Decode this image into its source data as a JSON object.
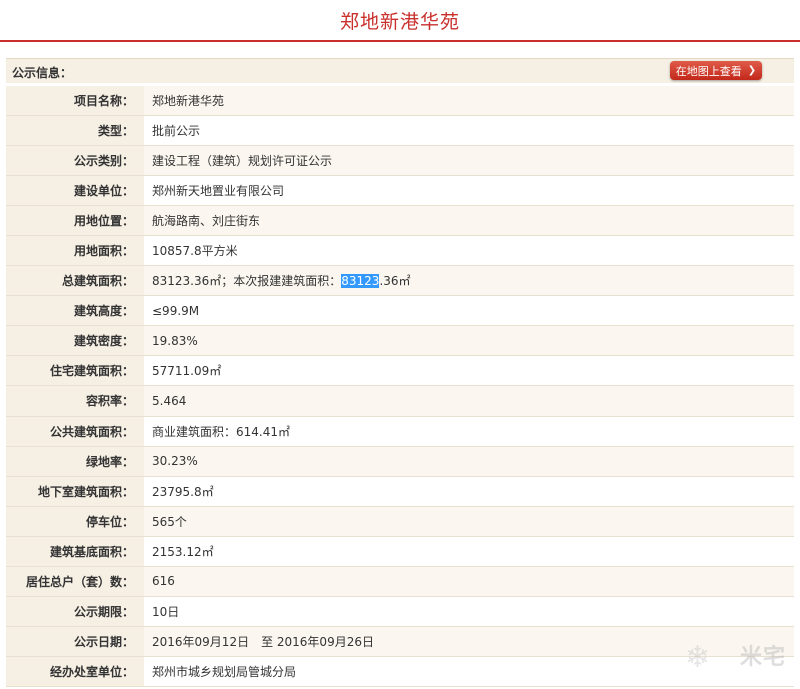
{
  "page": {
    "title": "郑地新港华苑"
  },
  "header": {
    "label": "公示信息：",
    "map_button": "在地图上查看"
  },
  "rows": [
    {
      "label": "项目名称：",
      "value": "郑地新港华苑"
    },
    {
      "label": "类型：",
      "value": "批前公示"
    },
    {
      "label": "公示类别：",
      "value": "建设工程（建筑）规划许可证公示"
    },
    {
      "label": "建设单位：",
      "value": "郑州新天地置业有限公司"
    },
    {
      "label": "用地位置：",
      "value": "航海路南、刘庄街东"
    },
    {
      "label": "用地面积：",
      "value": "10857.8平方米"
    },
    {
      "label": "总建筑面积：",
      "value": "83123.36㎡；本次报建建筑面积：",
      "highlight": "83123",
      "value_tail": ".36㎡"
    },
    {
      "label": "建筑高度：",
      "value": "≤99.9M"
    },
    {
      "label": "建筑密度：",
      "value": "19.83%"
    },
    {
      "label": "住宅建筑面积：",
      "value": "57711.09㎡"
    },
    {
      "label": "容积率：",
      "value": "5.464"
    },
    {
      "label": "公共建筑面积：",
      "value": "商业建筑面积：614.41㎡"
    },
    {
      "label": "绿地率：",
      "value": "30.23%"
    },
    {
      "label": "地下室建筑面积：",
      "value": "23795.8㎡"
    },
    {
      "label": "停车位：",
      "value": "565个"
    },
    {
      "label": "建筑基底面积：",
      "value": "2153.12㎡"
    },
    {
      "label": "居住总户（套）数：",
      "value": "616"
    },
    {
      "label": "公示期限：",
      "value": "10日"
    },
    {
      "label": "公示日期：",
      "value": "2016年09月12日　至 2016年09月26日"
    },
    {
      "label": "经办处室单位：",
      "value": "郑州市城乡规划局管城分局"
    }
  ],
  "watermark": "米宅",
  "icons": {
    "chevron": "chevron-right-icon",
    "watermark": "snowflake-icon"
  }
}
